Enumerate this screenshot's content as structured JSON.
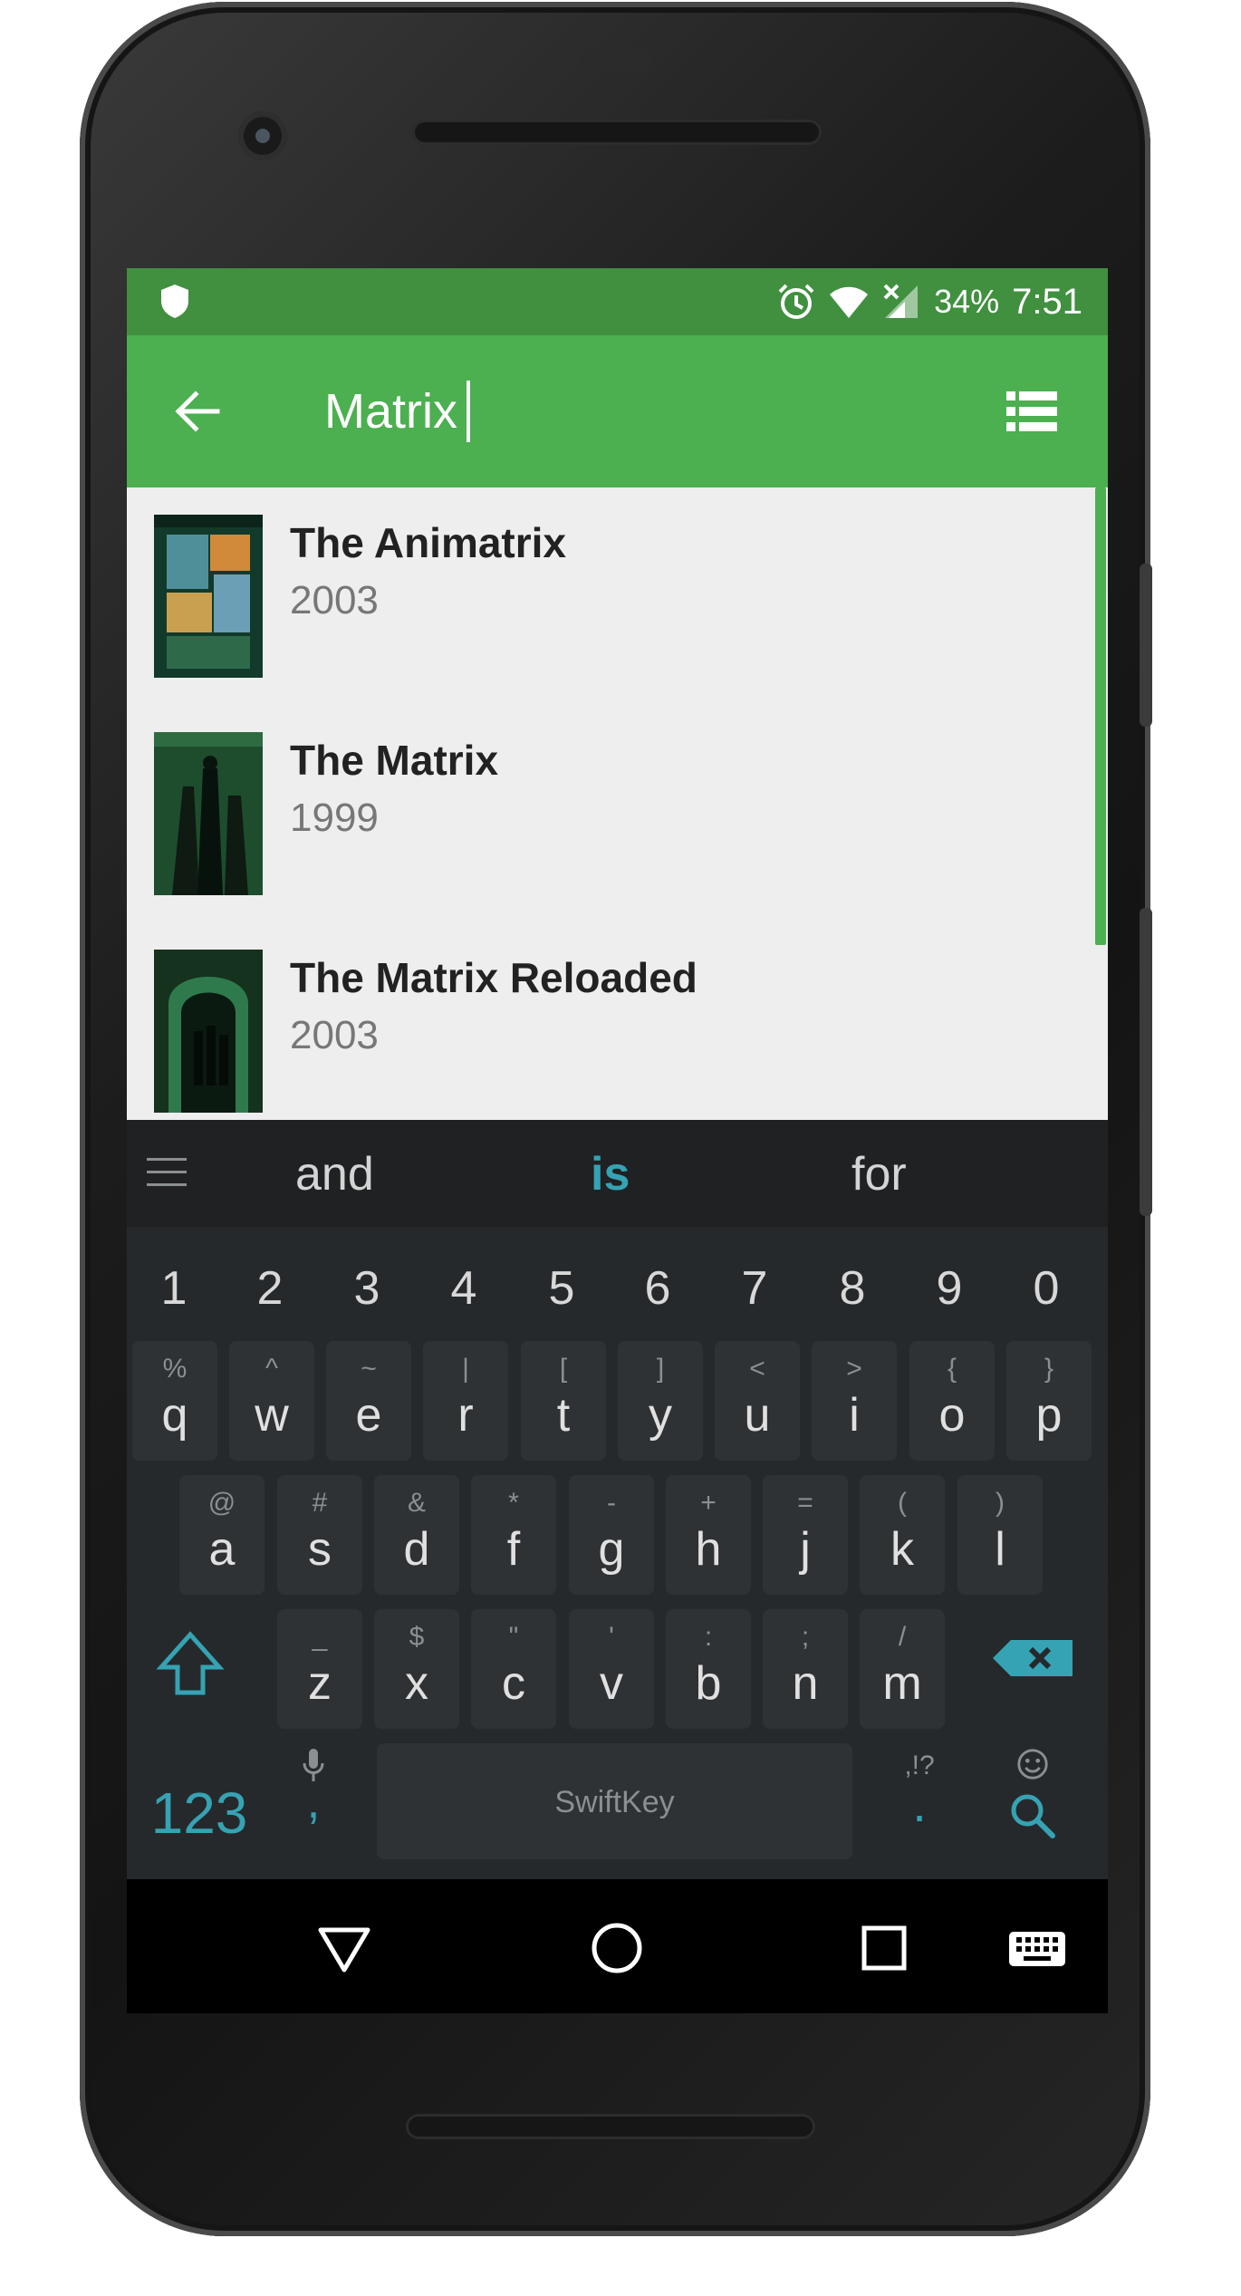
{
  "status_bar": {
    "battery": "34%",
    "time": "7:51",
    "icons": [
      "shield-icon",
      "alarm-icon",
      "wifi-icon",
      "signal-icon"
    ]
  },
  "toolbar": {
    "search_text": "Matrix",
    "back_icon": "arrow-left-icon",
    "view_icon": "list-view-icon"
  },
  "results": [
    {
      "title": "The Animatrix",
      "year": "2003"
    },
    {
      "title": "The Matrix",
      "year": "1999"
    },
    {
      "title": "The Matrix Reloaded",
      "year": "2003"
    }
  ],
  "keyboard": {
    "suggestions": [
      "and",
      "is",
      "for"
    ],
    "numbers": [
      "1",
      "2",
      "3",
      "4",
      "5",
      "6",
      "7",
      "8",
      "9",
      "0"
    ],
    "row1": [
      {
        "sec": "%",
        "pri": "q"
      },
      {
        "sec": "^",
        "pri": "w"
      },
      {
        "sec": "~",
        "pri": "e"
      },
      {
        "sec": "|",
        "pri": "r"
      },
      {
        "sec": "[",
        "pri": "t"
      },
      {
        "sec": "]",
        "pri": "y"
      },
      {
        "sec": "<",
        "pri": "u"
      },
      {
        "sec": ">",
        "pri": "i"
      },
      {
        "sec": "{",
        "pri": "o"
      },
      {
        "sec": "}",
        "pri": "p"
      }
    ],
    "row2": [
      {
        "sec": "@",
        "pri": "a"
      },
      {
        "sec": "#",
        "pri": "s"
      },
      {
        "sec": "&",
        "pri": "d"
      },
      {
        "sec": "*",
        "pri": "f"
      },
      {
        "sec": "-",
        "pri": "g"
      },
      {
        "sec": "+",
        "pri": "h"
      },
      {
        "sec": "=",
        "pri": "j"
      },
      {
        "sec": "(",
        "pri": "k"
      },
      {
        "sec": ")",
        "pri": "l"
      }
    ],
    "row3": [
      {
        "sec": "_",
        "pri": "z"
      },
      {
        "sec": "$",
        "pri": "x"
      },
      {
        "sec": "\"",
        "pri": "c"
      },
      {
        "sec": "'",
        "pri": "v"
      },
      {
        "sec": ":",
        "pri": "b"
      },
      {
        "sec": ";",
        "pri": "n"
      },
      {
        "sec": "/",
        "pri": "m"
      }
    ],
    "numbers_key": "123",
    "comma_key": ",",
    "space_label": "SwiftKey",
    "punct_hint": ",!?",
    "period_key": ".",
    "accent_color": "#35a3b3"
  },
  "colors": {
    "status_bar": "#40903f",
    "toolbar": "#4caf50",
    "list_bg": "#eeeeee"
  }
}
